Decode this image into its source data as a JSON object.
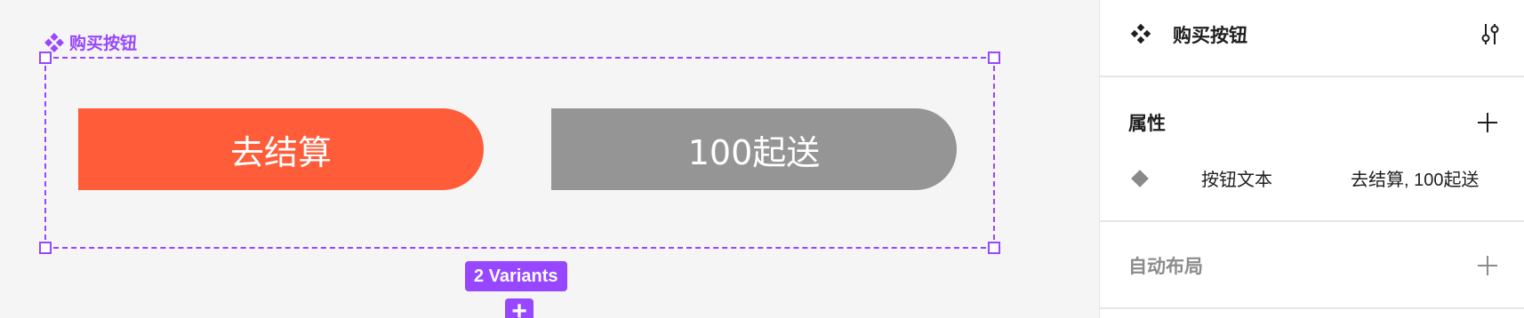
{
  "canvas": {
    "frame_label": "购买按钮",
    "variants": [
      {
        "text": "去结算",
        "color": "#ff5c39"
      },
      {
        "text": "100起送",
        "color": "#959595"
      }
    ],
    "variants_badge": "2 Variants",
    "accent_color": "#9747ff"
  },
  "panel": {
    "component_name": "购买按钮",
    "properties_title": "属性",
    "properties": [
      {
        "icon": "variant-diamond-icon",
        "name": "按钮文本",
        "value": "去结算, 100起送"
      }
    ],
    "auto_layout_title": "自动布局"
  }
}
